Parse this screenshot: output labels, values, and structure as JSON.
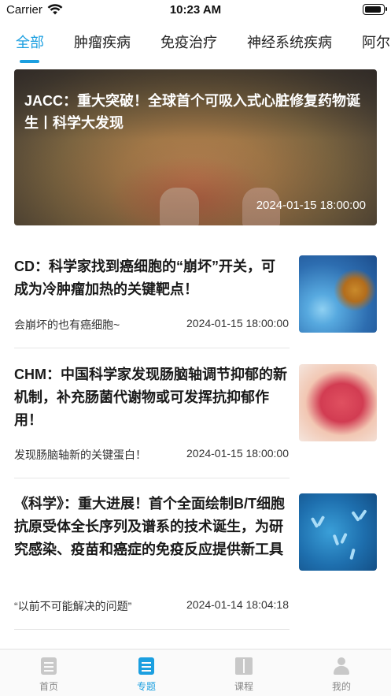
{
  "status_bar": {
    "carrier": "Carrier",
    "time": "10:23 AM"
  },
  "tabs": [
    {
      "label": "全部",
      "active": true
    },
    {
      "label": "肿瘤疾病",
      "active": false
    },
    {
      "label": "免疫治疗",
      "active": false
    },
    {
      "label": "神经系统疾病",
      "active": false
    },
    {
      "label": "阿尔",
      "active": false
    }
  ],
  "banner": {
    "title": "JACC：重大突破！全球首个可吸入式心脏修复药物诞生丨科学大发现",
    "date": "2024-01-15 18:00:00"
  },
  "articles": [
    {
      "title": "CD：科学家找到癌细胞的“崩坏”开关，可成为冷肿瘤加热的关键靶点！",
      "subtitle": "会崩坏的也有癌细胞~",
      "date": "2024-01-15 18:00:00",
      "thumb": "cancer-cells-image"
    },
    {
      "title": "CHM：中国科学家发现肠脑轴调节抑郁的新机制，补充肠菌代谢物或可发挥抗抑郁作用！",
      "subtitle": "发现肠脑轴新的关键蛋白！",
      "date": "2024-01-15 18:00:00",
      "thumb": "brain-in-hands-image"
    },
    {
      "title": "《科学》：重大进展！首个全面绘制B/T细胞抗原受体全长序列及谱系的技术诞生，为研究感染、疫苗和癌症的免疫反应提供新工具",
      "subtitle": "“以前不可能解决的问题”",
      "date": "2024-01-14 18:04:18",
      "thumb": "antibodies-image"
    }
  ],
  "bottom_nav": [
    {
      "label": "首页",
      "icon": "home-doc-icon",
      "active": false
    },
    {
      "label": "专题",
      "icon": "topic-list-icon",
      "active": true
    },
    {
      "label": "课程",
      "icon": "book-icon",
      "active": false
    },
    {
      "label": "我的",
      "icon": "person-icon",
      "active": false
    }
  ],
  "colors": {
    "accent": "#1b9fe0",
    "text": "#1a1a1a",
    "inactive": "#888888"
  }
}
